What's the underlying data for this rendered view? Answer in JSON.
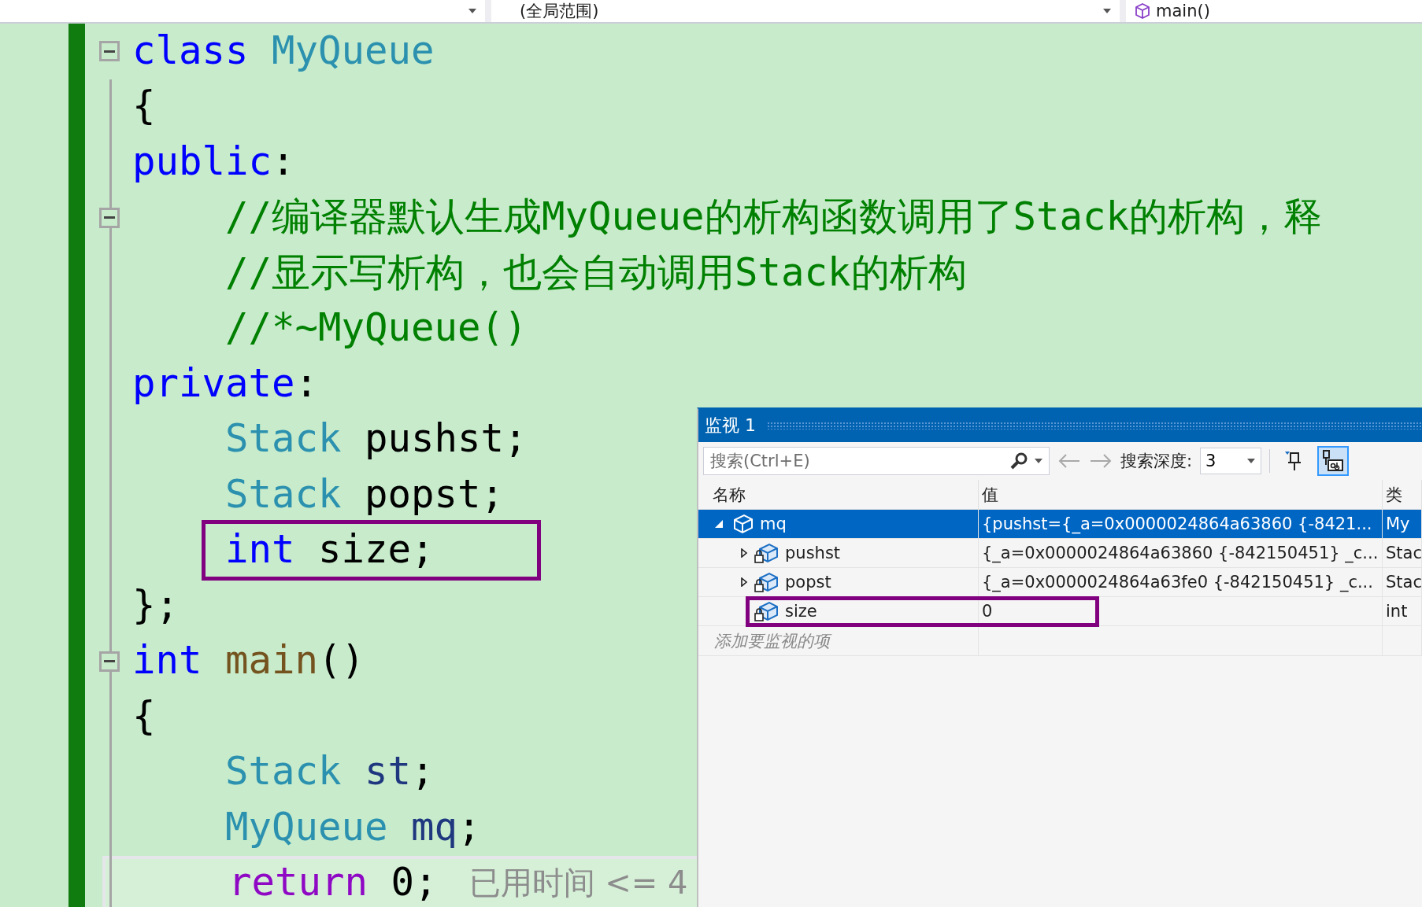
{
  "top_bar": {
    "dropdowns": [
      {
        "kind": "blank"
      },
      {
        "kind": "text",
        "text": "(全局范围)"
      },
      {
        "kind": "function",
        "text": "main()"
      }
    ]
  },
  "editor": {
    "lines": [
      {
        "fold": true,
        "tokens": [
          {
            "kind": "keyword",
            "text": "class"
          },
          {
            "kind": "type",
            "text": " MyQueue"
          }
        ]
      },
      {
        "tokens": [
          {
            "kind": "plain",
            "text": "{"
          }
        ]
      },
      {
        "tokens": [
          {
            "kind": "keyword",
            "text": "public"
          },
          {
            "kind": "plain",
            "text": ":"
          }
        ],
        "children": [
          {
            "fold": true,
            "tokens": [
              {
                "kind": "comment",
                "text": "//编译器默认生成MyQueue的析构函数调用了Stack的析构，释"
              }
            ]
          },
          {
            "tokens": [
              {
                "kind": "comment",
                "text": "//显示写析构，也会自动调用Stack的析构"
              }
            ]
          },
          {
            "tokens": [
              {
                "kind": "comment",
                "text": "//*~MyQueue()"
              }
            ]
          }
        ]
      },
      {
        "tokens": [
          {
            "kind": "keyword",
            "text": "private"
          },
          {
            "kind": "plain",
            "text": ":"
          }
        ],
        "children": [
          {
            "tokens": [
              {
                "kind": "type",
                "text": "Stack"
              },
              {
                "kind": "plain",
                "text": " pushst;"
              }
            ]
          },
          {
            "tokens": [
              {
                "kind": "type",
                "text": "Stack"
              },
              {
                "kind": "plain",
                "text": " popst;"
              }
            ]
          },
          {
            "highlighted": true,
            "tokens": [
              {
                "kind": "keyword",
                "text": "int"
              },
              {
                "kind": "plain",
                "text": " size;"
              }
            ]
          }
        ]
      },
      {
        "tokens": [
          {
            "kind": "plain",
            "text": "};"
          }
        ]
      },
      {
        "fold": true,
        "tokens": [
          {
            "kind": "keyword",
            "text": "int"
          },
          {
            "kind": "function",
            "text": " main"
          },
          {
            "kind": "plain",
            "text": "()"
          }
        ]
      },
      {
        "tokens": [
          {
            "kind": "plain",
            "text": "{"
          }
        ],
        "children": [
          {
            "tokens": [
              {
                "kind": "type",
                "text": "Stack"
              },
              {
                "kind": "local",
                "text": " st"
              },
              {
                "kind": "plain",
                "text": ";"
              }
            ]
          },
          {
            "tokens": [
              {
                "kind": "type",
                "text": "MyQueue"
              },
              {
                "kind": "local",
                "text": " mq"
              },
              {
                "kind": "plain",
                "text": ";"
              }
            ]
          },
          {
            "current": true,
            "tokens": [
              {
                "kind": "control",
                "text": "return"
              },
              {
                "kind": "plain",
                "text": " 0;"
              }
            ],
            "hint": "已用时间 <= 4"
          }
        ]
      }
    ]
  },
  "watch": {
    "title": "监视 1",
    "toolbar": {
      "search_placeholder": "搜索(Ctrl+E)",
      "depth_label": "搜索深度:",
      "depth": "3",
      "pin_selected": false,
      "ab_selected": true
    },
    "columns": [
      "名称",
      "值",
      "类"
    ],
    "rows": [
      {
        "name": "mq",
        "kind": "object",
        "value": "{pushst={_a=0x0000024864a63860 {-8421...",
        "type": "My",
        "selected": true,
        "expanded": true,
        "children": [
          {
            "name": "pushst",
            "kind": "member",
            "value": "{_a=0x0000024864a63860 {-842150451} _c...",
            "type": "Stac",
            "selected": false,
            "expanded": false
          },
          {
            "name": "popst",
            "kind": "member",
            "value": "{_a=0x0000024864a63fe0 {-842150451} _c...",
            "type": "Stac",
            "selected": false,
            "expanded": false
          },
          {
            "name": "size",
            "kind": "member",
            "value": "0",
            "type": "int",
            "selected": false,
            "highlighted": true
          }
        ]
      }
    ],
    "add_placeholder": "添加要监视的项"
  }
}
